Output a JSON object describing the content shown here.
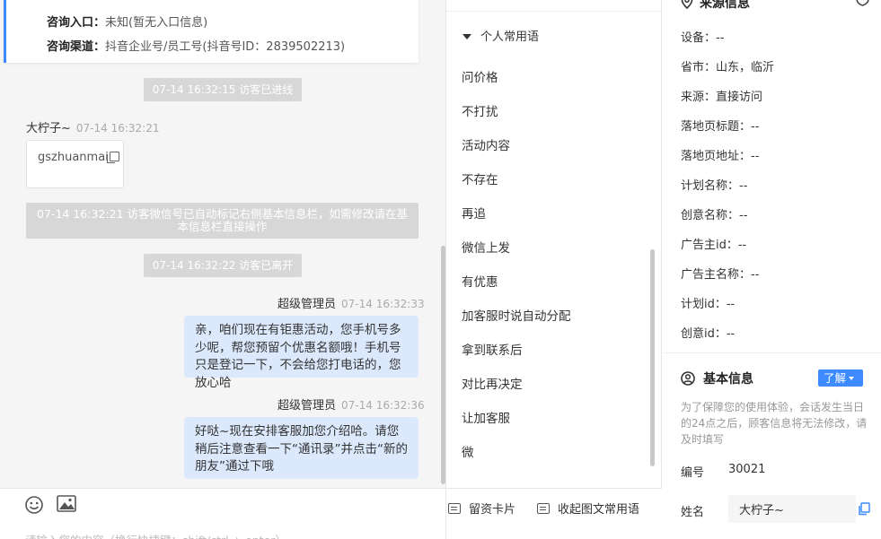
{
  "chat": {
    "info_card": {
      "entry_label": "咨询入口：",
      "entry_value": "未知(暂无入口信息)",
      "channel_label": "咨询渠道：",
      "channel_value": "抖音企业号/员工号(抖音号ID：2839502213)"
    },
    "system_enter": "07-14 16:32:15 访客已进线",
    "visitor_name": "大柠子~",
    "visitor_time": "07-14 16:32:21",
    "visitor_message": "gszhuanmai",
    "system_wechat": "07-14 16:32:21 访客微信号已自动标记右侧基本信息栏，如需修改请在基本信息栏直接操作",
    "system_leave": "07-14 16:32:22 访客已离开",
    "agent_messages": [
      {
        "sender": "超级管理员",
        "time": "07-14 16:32:33",
        "text": "亲，咱们现在有钜惠活动，您手机号多少呢，帮您预留个优惠名额哦！手机号只是登记一下，不会给您打电话的，您放心哈"
      },
      {
        "sender": "超级管理员",
        "time": "07-14 16:32:36",
        "text": "好哒~现在安排客服加您介绍哈。请您稍后注意查看一下“通讯录”并点击“新的朋友”通过下哦"
      }
    ],
    "composer_placeholder": "请输入您的内容（换行快捷键：shift/ctrl + enter）"
  },
  "phrases": {
    "header": "个人常用语",
    "items": [
      "问价格",
      "不打扰",
      "活动内容",
      "不存在",
      "再追",
      "微信上发",
      "有优惠",
      "加客服时说自动分配",
      "拿到联系后",
      "对比再决定",
      "让加客服",
      "微"
    ],
    "card_button": "留资卡片",
    "collapse_button": "收起图文常用语"
  },
  "side": {
    "source_title": "来源信息",
    "source_rows": [
      "设备：--",
      "省市：山东，临沂",
      "来源：直接访问",
      "落地页标题：--",
      "落地页地址：--",
      "计划名称：--",
      "创意名称：--",
      "广告主id：--",
      "广告主名称：--",
      "计划id：--",
      "创意id：--"
    ],
    "basic_title": "基本信息",
    "learn_button": "了解",
    "notice": "为了保障您的使用体验，会话发生当日的24点之后，顾客信息将无法修改，请及时填写",
    "id_label": "编号",
    "id_value": "30021",
    "name_label": "姓名",
    "name_value": "大柠子~"
  },
  "colors": {
    "accent": "#3d8bff",
    "bubble": "#dce9fd",
    "system_msg": "#d7d7d7"
  }
}
